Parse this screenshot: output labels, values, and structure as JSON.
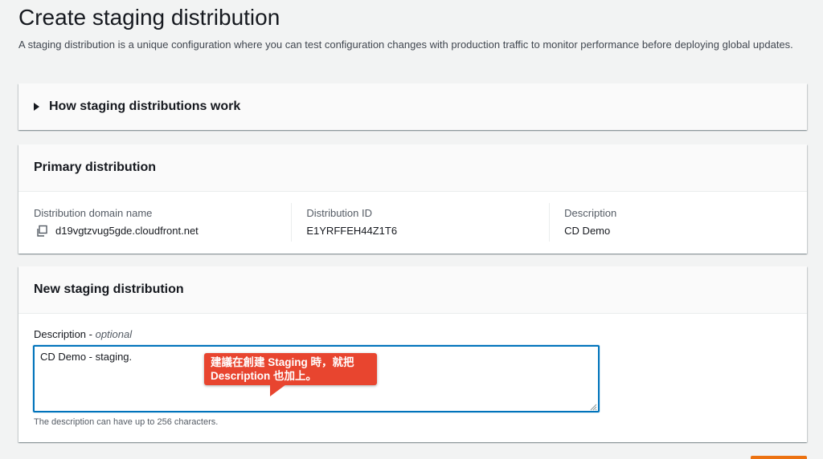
{
  "page": {
    "title": "Create staging distribution",
    "description": "A staging distribution is a unique configuration where you can test configuration changes with production traffic to monitor performance before deploying global updates."
  },
  "how_it_works": {
    "title": "How staging distributions work"
  },
  "primary": {
    "title": "Primary distribution",
    "fields": [
      {
        "label": "Distribution domain name",
        "value": "d19vgtzvug5gde.cloudfront.net"
      },
      {
        "label": "Distribution ID",
        "value": "E1YRFFEH44Z1T6"
      },
      {
        "label": "Description",
        "value": "CD Demo"
      }
    ]
  },
  "new_staging": {
    "title": "New staging distribution",
    "description_label": "Description",
    "description_optional": "optional",
    "description_value": "CD Demo - staging.",
    "description_hint": "The description can have up to 256 characters."
  },
  "annotation": {
    "line1": "建議在創建 Staging 時，就把",
    "line2": "Description 也加上。"
  },
  "colors": {
    "focus_border": "#0073bb",
    "callout": "#e8452f",
    "primary_button": "#ec7211"
  },
  "icons": {
    "expand": "caret-right-icon",
    "copy": "copy-icon"
  }
}
